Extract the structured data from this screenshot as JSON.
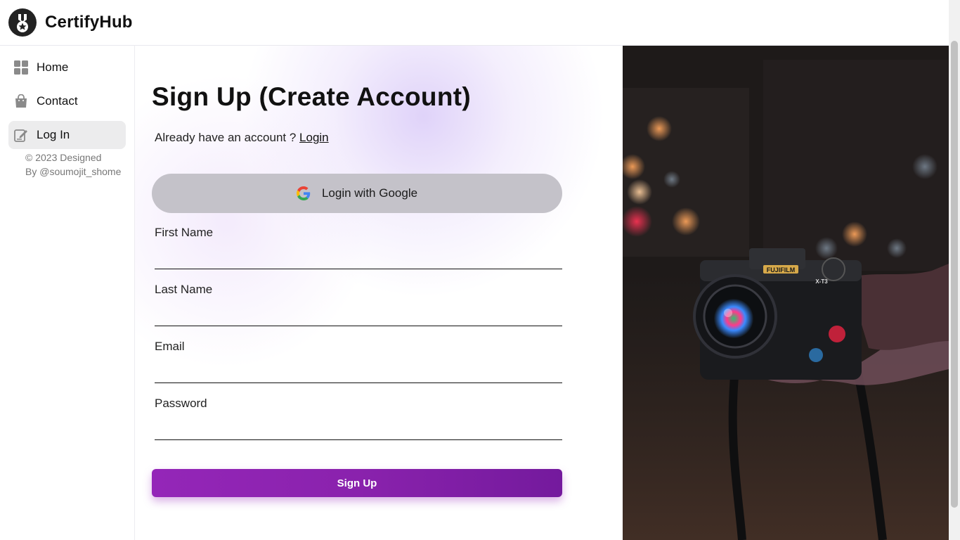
{
  "header": {
    "brand": "CertifyHub",
    "logo_icon": "medal-icon"
  },
  "sidebar": {
    "items": [
      {
        "label": "Home",
        "icon": "grid-icon",
        "active": false
      },
      {
        "label": "Contact",
        "icon": "shopping-bag-icon",
        "active": false
      },
      {
        "label": "Log In",
        "icon": "edit-icon",
        "active": true
      }
    ],
    "copyright_line1": "© 2023 Designed",
    "copyright_line2": "By @soumojit_shome"
  },
  "main": {
    "title": "Sign Up (Create Account)",
    "already_text": "Already have an account ? ",
    "login_link": "Login",
    "google_label": "Login with Google",
    "fields": [
      {
        "label": "First Name",
        "value": ""
      },
      {
        "label": "Last Name",
        "value": ""
      },
      {
        "label": "Email",
        "value": ""
      },
      {
        "label": "Password",
        "value": ""
      }
    ],
    "submit_label": "Sign Up"
  },
  "photo": {
    "camera_brand": "FUJIFILM",
    "camera_model": "X-T3"
  },
  "colors": {
    "accent": "#8a22ad",
    "google_btn_bg": "#c4c2c9",
    "active_nav_bg": "#ececed"
  }
}
